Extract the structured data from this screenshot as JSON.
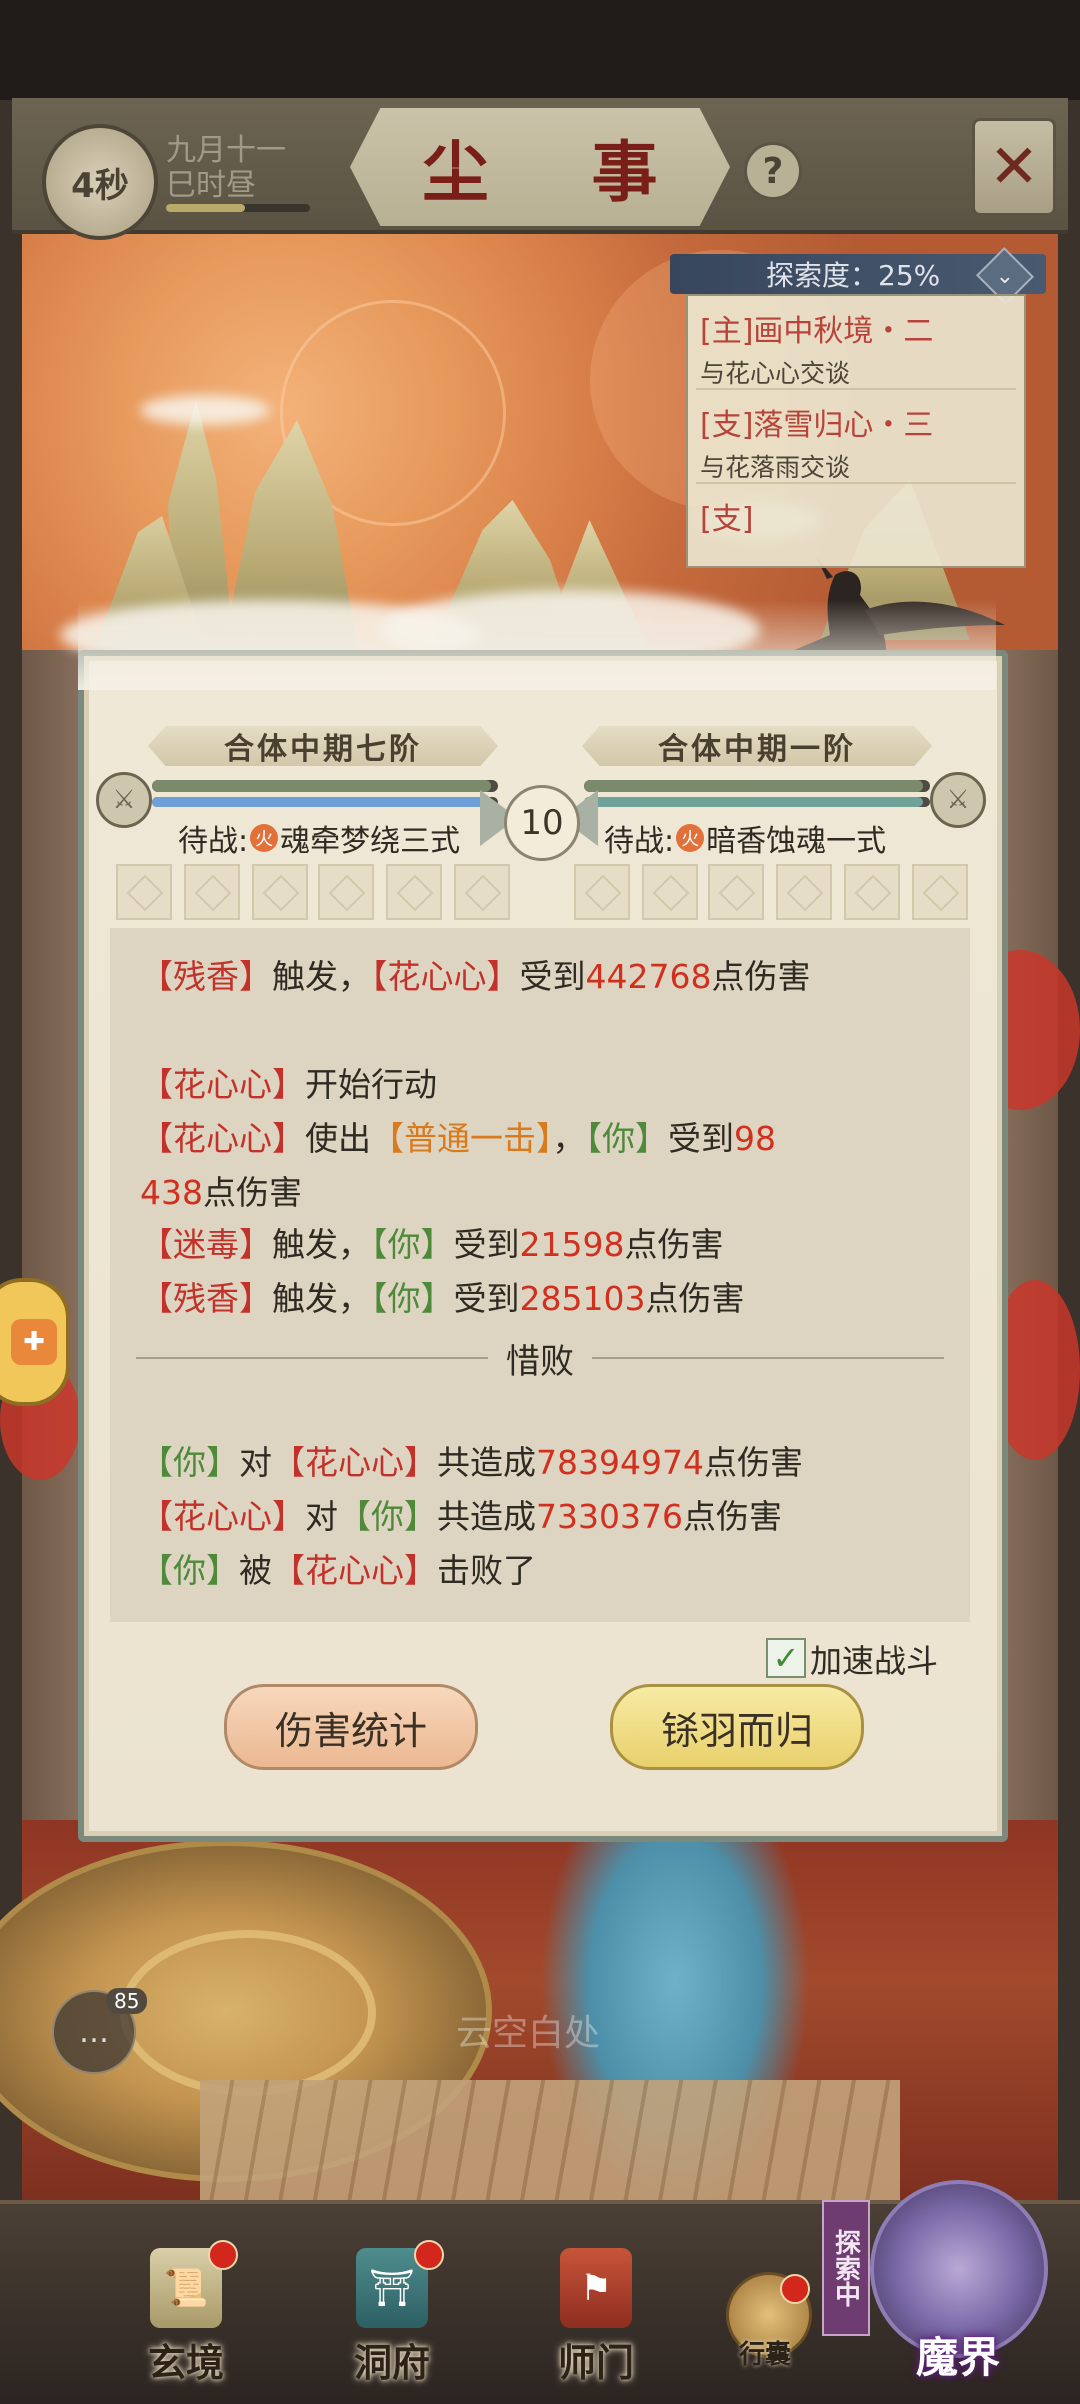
{
  "header": {
    "timer": "4秒",
    "date_line1": "九月十一",
    "date_line2": "巳时昼",
    "date_progress": 0.55,
    "title": "尘 事",
    "help_icon": "question-icon",
    "close_icon": "close-x-icon"
  },
  "quests": {
    "progress": "探索度：25%",
    "items": [
      {
        "title": "[主]画中秋境・二",
        "subtitle": "与花心心交谈"
      },
      {
        "title": "[支]落雪归心・三",
        "subtitle": "与花落雨交谈"
      },
      {
        "title": "[支]",
        "subtitle": ""
      }
    ]
  },
  "battle": {
    "left": {
      "rank": "合体中期七阶",
      "standby_prefix": "待战:",
      "element": "火",
      "skill": "魂牵梦绕三式",
      "hp": 0.98,
      "mp": 0.98
    },
    "right": {
      "rank": "合体中期一阶",
      "standby_prefix": "待战:",
      "element": "火",
      "skill": "暗香蚀魂一式",
      "hp": 0.98,
      "mp": 0.98
    },
    "round": "10",
    "log": {
      "l1": {
        "a": "【残香】",
        "b": "触发，",
        "c": "【花心心】",
        "d": "受到",
        "e": "442768",
        "f": "点伤害"
      },
      "l2": {
        "a": "【花心心】",
        "b": "开始行动"
      },
      "l3": {
        "a": "【花心心】",
        "b": "使出",
        "c": "【普通一击】",
        "d": "，",
        "e": "【你】",
        "f": "受到",
        "g": "98"
      },
      "l4": {
        "a": "438",
        "b": "点伤害"
      },
      "l5": {
        "a": "【迷毒】",
        "b": "触发，",
        "c": "【你】",
        "d": "受到",
        "e": "21598",
        "f": "点伤害"
      },
      "l6": {
        "a": "【残香】",
        "b": "触发，",
        "c": "【你】",
        "d": "受到",
        "e": "285103",
        "f": "点伤害"
      },
      "result": "惜败",
      "s1": {
        "a": "【你】",
        "b": "对",
        "c": "【花心心】",
        "d": "共造成",
        "e": "78394974",
        "f": "点伤害"
      },
      "s2": {
        "a": "【花心心】",
        "b": "对",
        "c": "【你】",
        "d": "共造成",
        "e": "7330376",
        "f": "点伤害"
      },
      "s3": {
        "a": "【你】",
        "b": "被",
        "c": "【花心心】",
        "d": "击败了"
      }
    },
    "speed_label": "加速战斗",
    "speed_checked": true,
    "btn_stats": "伤害统计",
    "btn_return": "铩羽而归"
  },
  "chat": {
    "badge": "85",
    "ghost": "云空白处"
  },
  "nav": {
    "items": [
      {
        "label": "玄境",
        "has_dot": true
      },
      {
        "label": "洞府",
        "has_dot": true
      },
      {
        "label": "师门",
        "has_dot": false
      }
    ],
    "bag": "行囊",
    "explore_tag": "探索中",
    "demon": "魔界"
  },
  "colors": {
    "damage_red": "#d2301f",
    "enemy_name": "#c2322a",
    "player_name": "#4e8a3a",
    "skill_orange": "#d87a1e",
    "title_red": "#7a1f18"
  }
}
